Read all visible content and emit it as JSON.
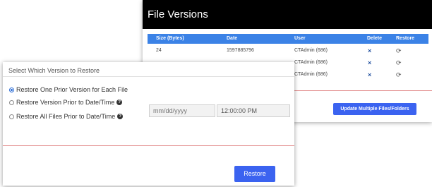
{
  "file_versions": {
    "title": "File Versions",
    "columns": {
      "size": "Size (Bytes)",
      "date": "Date",
      "user": "User",
      "delete": "Delete",
      "restore": "Restore"
    },
    "rows": [
      {
        "size": "24",
        "date": "1597885796",
        "user": "CTAdmin (686)"
      },
      {
        "size": "",
        "date": "",
        "user": "CTAdmin (686)"
      },
      {
        "size": "",
        "date": "",
        "user": "CTAdmin (686)"
      }
    ],
    "delete_icon": "×",
    "restore_icon": "⟳",
    "update_button": "Update Multiple Files/Folders"
  },
  "restore_dialog": {
    "title": "Select Which Version to Restore",
    "options": [
      {
        "label": "Restore One Prior Version for Each File",
        "checked": true
      },
      {
        "label": "Restore Version Prior to Date/Time",
        "checked": false
      },
      {
        "label": "Restore All Files Prior to Date/Time",
        "checked": false
      }
    ],
    "help_icon": "?",
    "date_placeholder": "mm/dd/yyyy",
    "time_value": "12:00:00 PM",
    "restore_button": "Restore"
  },
  "colors": {
    "header_bg": "#000000",
    "table_head_bg": "#3b82e6",
    "button_bg": "#3b63f0",
    "divider": "#e28b8b",
    "delete_icon": "#1f4f9e"
  }
}
